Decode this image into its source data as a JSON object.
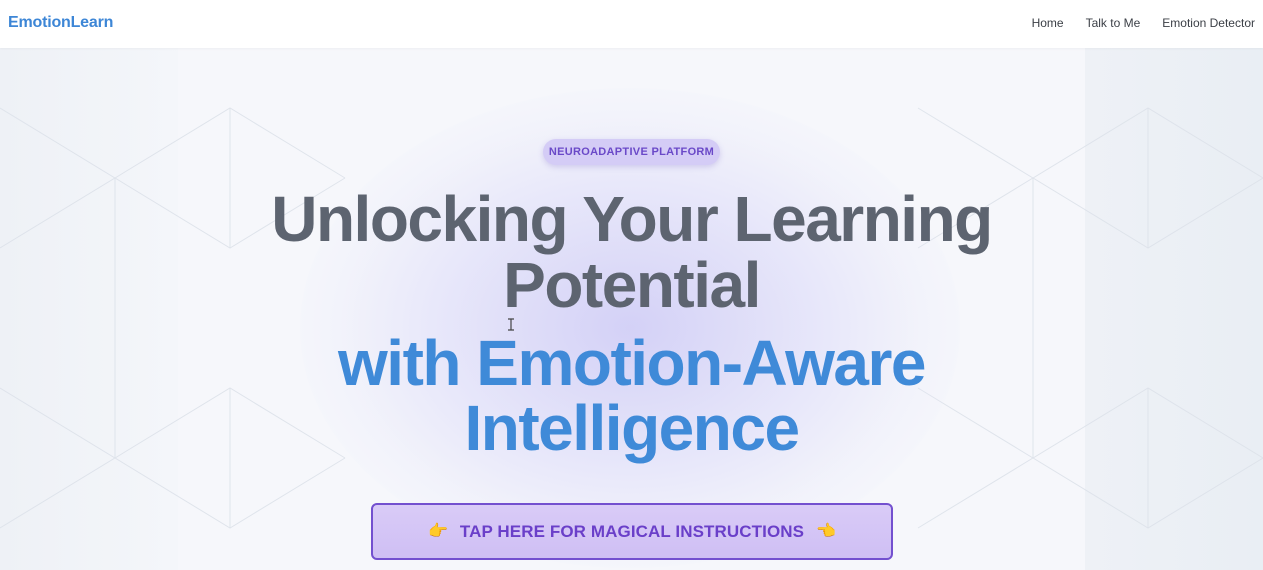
{
  "navbar": {
    "brand": "EmotionLearn",
    "links": [
      "Home",
      "Talk to Me",
      "Emotion Detector"
    ]
  },
  "hero": {
    "badge": "NEUROADAPTIVE PLATFORM",
    "title_lines": [
      "Unlocking Your Learning",
      "Potential",
      "with Emotion-Aware",
      "Intelligence"
    ],
    "cta": {
      "left_emoji": "👉",
      "label": "TAP HERE FOR MAGICAL INSTRUCTIONS",
      "right_emoji": "👈"
    }
  },
  "colors": {
    "brand": "#3d86d6",
    "title_gray": "#5d6470",
    "title_blue": "#3f8ad8",
    "accent_purple": "#6a3fc9",
    "cta_border": "#7350cf",
    "badge_bg": "#d4ccf6"
  },
  "icons": {
    "cursor": "text-cursor-icon",
    "cta_left": "pointing-right-hand-icon",
    "cta_right": "pointing-left-hand-icon"
  }
}
